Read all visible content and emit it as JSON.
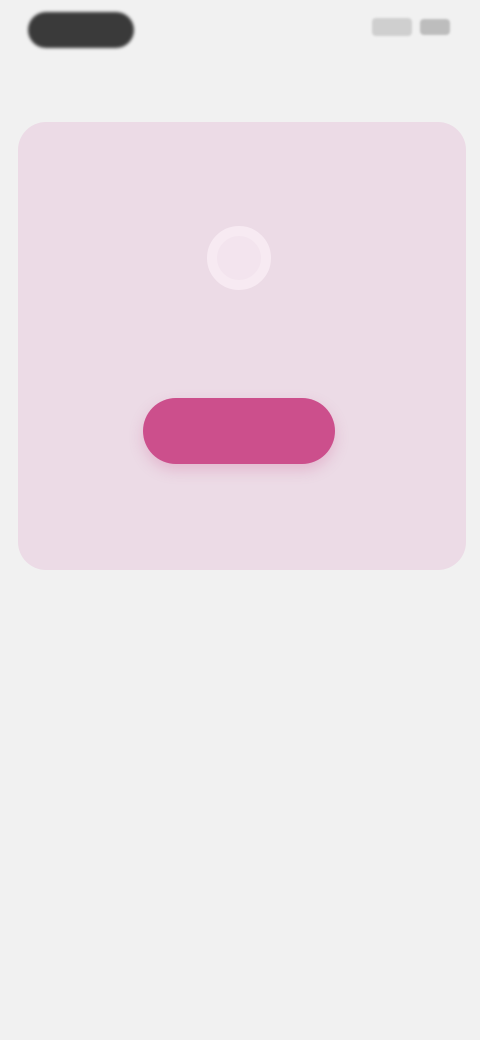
{
  "status_bar": {
    "time": "",
    "signal_icon": "signal-icon",
    "battery_icon": "battery-icon"
  },
  "header": {
    "title": ""
  },
  "card": {
    "background": "#ecdbe6",
    "icon": "ring-icon",
    "label": "",
    "sublabel": "",
    "button_label": "",
    "accent": "#cc4f8c"
  },
  "info": {
    "title": "",
    "body": "",
    "footnote": ""
  }
}
